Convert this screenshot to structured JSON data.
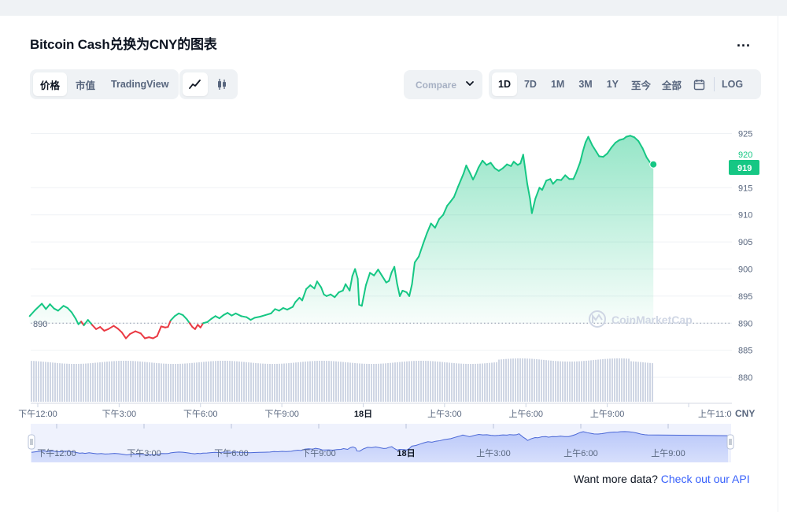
{
  "title": "Bitcoin Cash兑换为CNY的图表",
  "more_label": "...",
  "view_tabs": [
    "价格",
    "市值",
    "TradingView"
  ],
  "compare_placeholder": "Compare",
  "range_tabs": [
    "1D",
    "7D",
    "1M",
    "3M",
    "1Y",
    "至今",
    "全部"
  ],
  "log_label": "LOG",
  "footer": {
    "text": "Want more data?",
    "link": "Check out our API"
  },
  "watermark": "CoinMarketCap",
  "colors": {
    "up": "#16c784",
    "down": "#ea3943",
    "accent": "#3861fb",
    "grid": "#eff2f5"
  },
  "chart_data": {
    "type": "line",
    "currency": "CNY",
    "baseline": 890,
    "baseline_label": "890",
    "current_price": 919,
    "current_price_label": "919",
    "partial_tick_label": "920",
    "ylim": [
      875.5,
      929
    ],
    "y_ticks": [
      925,
      915,
      910,
      905,
      900,
      895,
      890,
      885,
      880
    ],
    "x_tick_labels": [
      "下午12:00",
      "下午3:00",
      "下午6:00",
      "下午9:00",
      "18日",
      "上午3:00",
      "上午6:00",
      "上午9:00",
      "上午11:0"
    ],
    "x_tick_hours": [
      0,
      3,
      6,
      9,
      12,
      15,
      18,
      21,
      24
    ],
    "navigator_tick_labels": [
      "下午12:00",
      "下午3:00",
      "下午6:00",
      "下午9:00",
      "18日",
      "上午3:00",
      "上午6:00",
      "上午9:00"
    ],
    "xlim_hours": [
      0,
      24.2
    ],
    "series": [
      {
        "values": [
          [
            -0.3,
            891.3
          ],
          [
            -0.1,
            892.4
          ],
          [
            0.15,
            893.6
          ],
          [
            0.3,
            892.6
          ],
          [
            0.45,
            893.5
          ],
          [
            0.6,
            892.7
          ],
          [
            0.75,
            892.3
          ],
          [
            0.95,
            893.2
          ],
          [
            1.1,
            892.8
          ],
          [
            1.25,
            892.0
          ],
          [
            1.4,
            890.8
          ],
          [
            1.5,
            889.8
          ],
          [
            1.6,
            890.3
          ],
          [
            1.7,
            889.6
          ],
          [
            1.85,
            890.6
          ],
          [
            2.0,
            889.7
          ],
          [
            2.15,
            888.9
          ],
          [
            2.3,
            889.3
          ],
          [
            2.45,
            888.6
          ],
          [
            2.6,
            888.9
          ],
          [
            2.8,
            889.5
          ],
          [
            2.95,
            889.0
          ],
          [
            3.1,
            888.3
          ],
          [
            3.25,
            887.2
          ],
          [
            3.4,
            888.0
          ],
          [
            3.6,
            888.5
          ],
          [
            3.8,
            888.1
          ],
          [
            3.95,
            887.2
          ],
          [
            4.1,
            887.4
          ],
          [
            4.25,
            887.2
          ],
          [
            4.4,
            887.6
          ],
          [
            4.55,
            889.4
          ],
          [
            4.7,
            889.2
          ],
          [
            4.8,
            889.3
          ],
          [
            4.9,
            890.5
          ],
          [
            5.05,
            891.3
          ],
          [
            5.2,
            891.8
          ],
          [
            5.35,
            891.5
          ],
          [
            5.5,
            890.7
          ],
          [
            5.6,
            890.0
          ],
          [
            5.7,
            889.3
          ],
          [
            5.8,
            888.9
          ],
          [
            5.9,
            889.7
          ],
          [
            6.0,
            889.2
          ],
          [
            6.1,
            890.0
          ],
          [
            6.25,
            890.2
          ],
          [
            6.4,
            890.8
          ],
          [
            6.55,
            891.3
          ],
          [
            6.7,
            890.9
          ],
          [
            6.85,
            891.5
          ],
          [
            7.0,
            891.9
          ],
          [
            7.15,
            891.4
          ],
          [
            7.3,
            891.8
          ],
          [
            7.5,
            891.3
          ],
          [
            7.7,
            891.1
          ],
          [
            7.85,
            890.6
          ],
          [
            8.0,
            891.0
          ],
          [
            8.2,
            891.2
          ],
          [
            8.4,
            891.5
          ],
          [
            8.6,
            891.8
          ],
          [
            8.75,
            892.6
          ],
          [
            8.9,
            892.3
          ],
          [
            9.05,
            892.8
          ],
          [
            9.2,
            892.5
          ],
          [
            9.4,
            893.0
          ],
          [
            9.5,
            893.9
          ],
          [
            9.65,
            894.7
          ],
          [
            9.75,
            894.2
          ],
          [
            9.9,
            896.3
          ],
          [
            10.05,
            897.0
          ],
          [
            10.2,
            896.4
          ],
          [
            10.3,
            897.7
          ],
          [
            10.45,
            896.6
          ],
          [
            10.55,
            895.3
          ],
          [
            10.65,
            895.0
          ],
          [
            10.8,
            895.3
          ],
          [
            10.95,
            894.8
          ],
          [
            11.1,
            895.7
          ],
          [
            11.25,
            896.0
          ],
          [
            11.35,
            897.2
          ],
          [
            11.5,
            896.0
          ],
          [
            11.6,
            898.7
          ],
          [
            11.7,
            900.0
          ],
          [
            11.8,
            898.2
          ],
          [
            11.85,
            893.4
          ],
          [
            11.95,
            893.2
          ],
          [
            12.1,
            897.0
          ],
          [
            12.25,
            899.3
          ],
          [
            12.4,
            898.8
          ],
          [
            12.55,
            899.9
          ],
          [
            12.7,
            898.7
          ],
          [
            12.85,
            897.5
          ],
          [
            12.95,
            897.8
          ],
          [
            13.05,
            899.4
          ],
          [
            13.15,
            900.4
          ],
          [
            13.25,
            897.3
          ],
          [
            13.35,
            895.0
          ],
          [
            13.45,
            896.0
          ],
          [
            13.6,
            895.7
          ],
          [
            13.7,
            895.0
          ],
          [
            13.8,
            897.2
          ],
          [
            13.9,
            901.2
          ],
          [
            14.05,
            902.3
          ],
          [
            14.2,
            904.5
          ],
          [
            14.35,
            906.6
          ],
          [
            14.5,
            908.4
          ],
          [
            14.65,
            907.6
          ],
          [
            14.8,
            909.2
          ],
          [
            14.95,
            910.0
          ],
          [
            15.1,
            911.7
          ],
          [
            15.2,
            912.3
          ],
          [
            15.35,
            913.3
          ],
          [
            15.5,
            915.2
          ],
          [
            15.6,
            916.4
          ],
          [
            15.7,
            917.6
          ],
          [
            15.8,
            919.1
          ],
          [
            15.95,
            917.6
          ],
          [
            16.05,
            916.5
          ],
          [
            16.15,
            917.5
          ],
          [
            16.25,
            918.7
          ],
          [
            16.4,
            920.0
          ],
          [
            16.55,
            919.2
          ],
          [
            16.7,
            919.6
          ],
          [
            16.85,
            918.6
          ],
          [
            17.0,
            918.1
          ],
          [
            17.15,
            918.6
          ],
          [
            17.3,
            919.3
          ],
          [
            17.45,
            919.0
          ],
          [
            17.55,
            919.8
          ],
          [
            17.7,
            919.2
          ],
          [
            17.8,
            919.5
          ],
          [
            17.9,
            921.1
          ],
          [
            17.95,
            919.3
          ],
          [
            18.05,
            915.7
          ],
          [
            18.15,
            913.0
          ],
          [
            18.22,
            910.3
          ],
          [
            18.35,
            913.0
          ],
          [
            18.5,
            915.0
          ],
          [
            18.6,
            914.6
          ],
          [
            18.75,
            916.3
          ],
          [
            18.9,
            916.6
          ],
          [
            19.0,
            915.7
          ],
          [
            19.15,
            916.5
          ],
          [
            19.3,
            916.4
          ],
          [
            19.45,
            917.3
          ],
          [
            19.6,
            916.6
          ],
          [
            19.75,
            916.6
          ],
          [
            19.85,
            917.7
          ],
          [
            20.0,
            919.7
          ],
          [
            20.1,
            921.7
          ],
          [
            20.2,
            923.4
          ],
          [
            20.3,
            924.4
          ],
          [
            20.45,
            922.8
          ],
          [
            20.6,
            921.6
          ],
          [
            20.7,
            920.8
          ],
          [
            20.85,
            920.7
          ],
          [
            21.0,
            921.3
          ],
          [
            21.15,
            922.4
          ],
          [
            21.3,
            923.3
          ],
          [
            21.45,
            923.8
          ],
          [
            21.6,
            924.0
          ],
          [
            21.7,
            924.4
          ],
          [
            21.85,
            924.6
          ],
          [
            22.0,
            924.3
          ],
          [
            22.15,
            923.6
          ],
          [
            22.3,
            922.3
          ],
          [
            22.45,
            920.6
          ],
          [
            22.6,
            919.5
          ],
          [
            22.7,
            919.3
          ]
        ]
      }
    ]
  }
}
